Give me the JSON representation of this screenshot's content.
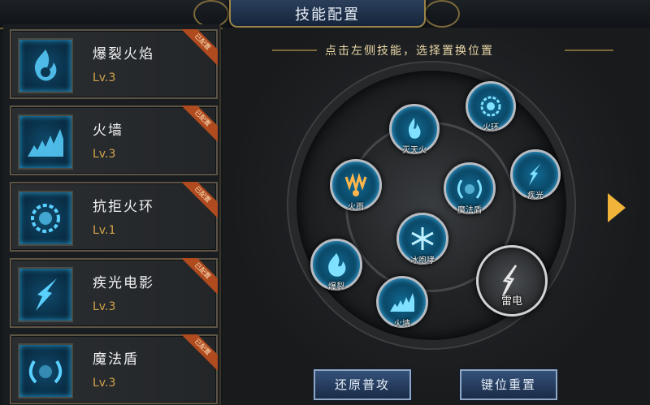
{
  "title": "技能配置",
  "hint": "点击左侧技能，选择置换位置",
  "badge_text": "已配置",
  "skills": [
    {
      "name": "爆裂火焰",
      "level": "Lv.3",
      "icon": "flame-burst-icon"
    },
    {
      "name": "火墙",
      "level": "Lv.3",
      "icon": "fire-wall-icon"
    },
    {
      "name": "抗拒火环",
      "level": "Lv.1",
      "icon": "repel-ring-icon"
    },
    {
      "name": "疾光电影",
      "level": "Lv.3",
      "icon": "lightning-bolt-icon"
    },
    {
      "name": "魔法盾",
      "level": "Lv.3",
      "icon": "magic-shield-icon"
    }
  ],
  "wheel": {
    "slots": [
      {
        "label": "灭天火",
        "icon": "heaven-fire-icon"
      },
      {
        "label": "火环",
        "icon": "fire-ring-icon"
      },
      {
        "label": "火雨",
        "icon": "fire-rain-icon"
      },
      {
        "label": "魔法盾",
        "icon": "magic-shield-icon"
      },
      {
        "label": "疾光",
        "icon": "lightning-icon"
      },
      {
        "label": "冰咆哮",
        "icon": "ice-roar-icon"
      },
      {
        "label": "爆裂",
        "icon": "burst-icon"
      },
      {
        "label": "火墙",
        "icon": "fire-wall-icon"
      },
      {
        "label": "雷电",
        "icon": "thunder-icon"
      }
    ]
  },
  "buttons": {
    "reset_basic": "还原普攻",
    "reset_keys": "键位重置"
  },
  "colors": {
    "accent_gold": "#d4a44a",
    "skill_blue": "#29a6dd",
    "badge_red": "#b04a1f"
  }
}
